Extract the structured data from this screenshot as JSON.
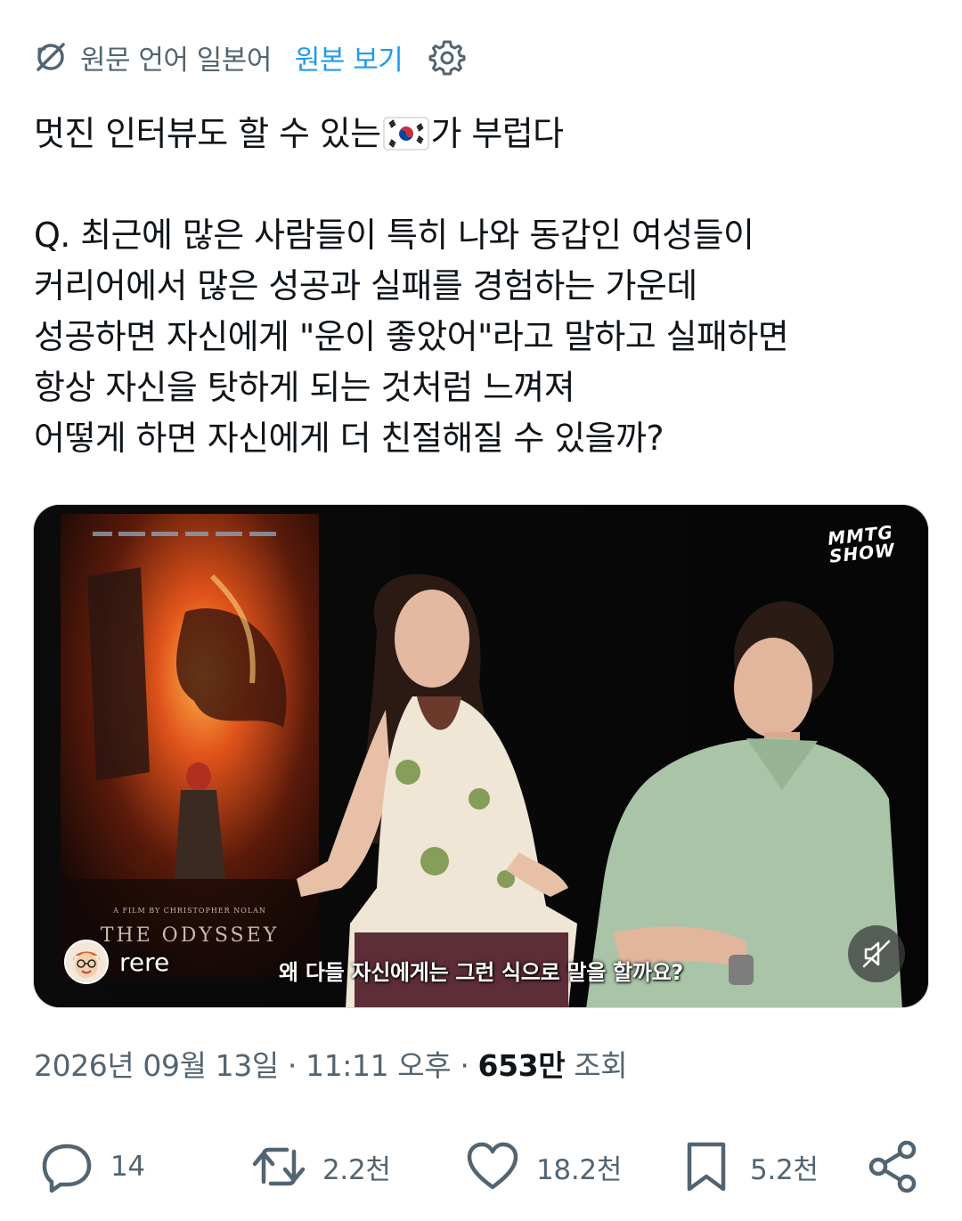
{
  "translation": {
    "original_language_text": "원문 언어 일본어",
    "view_original_label": "원본 보기",
    "icons": [
      "translate-icon",
      "settings-icon"
    ]
  },
  "tweet": {
    "line_1a": "멋진 인터뷰도 할 수 있는",
    "line_1_flag": "south-korea-flag-emoji",
    "line_1b": "가 부럽다",
    "question": "Q. 최근에 많은 사람들이 특히 나와 동갑인 여성들이\n커리어에서 많은 성공과 실패를 경험하는 가운데\n성공하면 자신에게 \"운이 좋았어\"라고 말하고 실패하면\n항상 자신을 탓하게 되는 것처럼 느껴져\n어떻게 하면 자신에게 더 친절해질 수 있을까?"
  },
  "media": {
    "brand_logo_line1": "MMTG",
    "brand_logo_line2": "SHOW",
    "poster_title": "THE ODYSSEY",
    "poster_subtitle": "A FILM BY CHRISTOPHER NOLAN",
    "author_name": "rere",
    "caption": "왜 다들 자신에게는 그런 식으로 말을 할까요?",
    "mute_icon": "speaker-muted-icon"
  },
  "meta": {
    "date": "2026년 09월 13일",
    "separator1": " · ",
    "time": "11:11 오후",
    "separator2": " · ",
    "views_count": "653만",
    "views_label": " 조회"
  },
  "actions": {
    "replies": "14",
    "retweets": "2.2천",
    "likes": "18.2천",
    "bookmarks": "5.2천"
  },
  "colors": {
    "text": "#0f1419",
    "secondary": "#536471",
    "accent": "#1d9bf0"
  }
}
